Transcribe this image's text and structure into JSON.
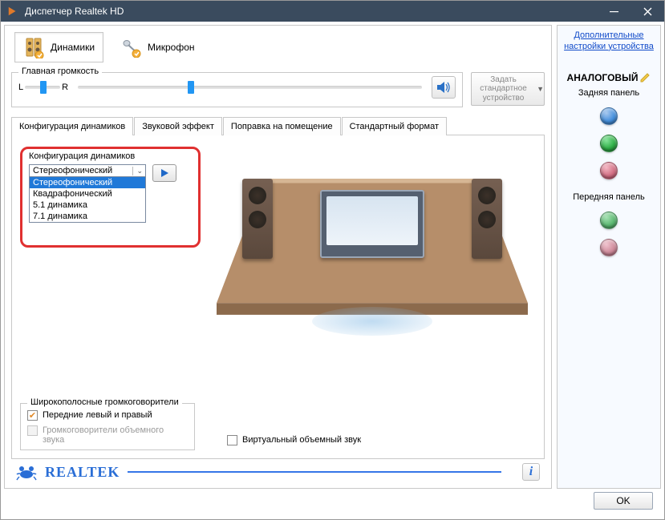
{
  "window": {
    "title": "Диспетчер Realtek HD"
  },
  "device_tabs": {
    "speakers": "Динамики",
    "microphone": "Микрофон"
  },
  "volume": {
    "group_label": "Главная громкость",
    "l": "L",
    "r": "R",
    "default_btn": "Задать стандартное устройство"
  },
  "tabs": {
    "cfg": "Конфигурация динамиков",
    "fx": "Звуковой эффект",
    "room": "Поправка на помещение",
    "fmt": "Стандартный формат"
  },
  "cfg": {
    "title": "Конфигурация динамиков",
    "selected": "Стереофонический",
    "options": [
      "Стереофонический",
      "Квадрафонический",
      "5.1 динамика",
      "7.1 динамика"
    ]
  },
  "wideband": {
    "title": "Широкополосные громкоговорители",
    "front": "Передние левый и правый",
    "surround": "Громкоговорители объемного звука"
  },
  "virtual": "Виртуальный объемный звук",
  "right": {
    "settings_link": "Дополнительные настройки устройства",
    "analog": "АНАЛОГОВЫЙ",
    "rear": "Задняя панель",
    "front": "Передняя панель"
  },
  "footer": {
    "ok": "OK",
    "brand": "REALTEK"
  },
  "colors": {
    "jack_blue": "radial-gradient(circle at 35% 30%, #a8c8ee, #4690dd 55%, #2b70b8)",
    "jack_green": "radial-gradient(circle at 35% 30%, #86e49a, #2fae46 55%, #1c7c2f)",
    "jack_pink": "radial-gradient(circle at 35% 30%, #f4b8c4, #d26f84 55%, #b84c64)",
    "jack_green2": "radial-gradient(circle at 35% 30%, #a8e2b4, #5cb872 55%, #3f9455)",
    "jack_pink2": "radial-gradient(circle at 35% 30%, #f0c4cf, #cf8b9b 55%, #b3697c)"
  }
}
